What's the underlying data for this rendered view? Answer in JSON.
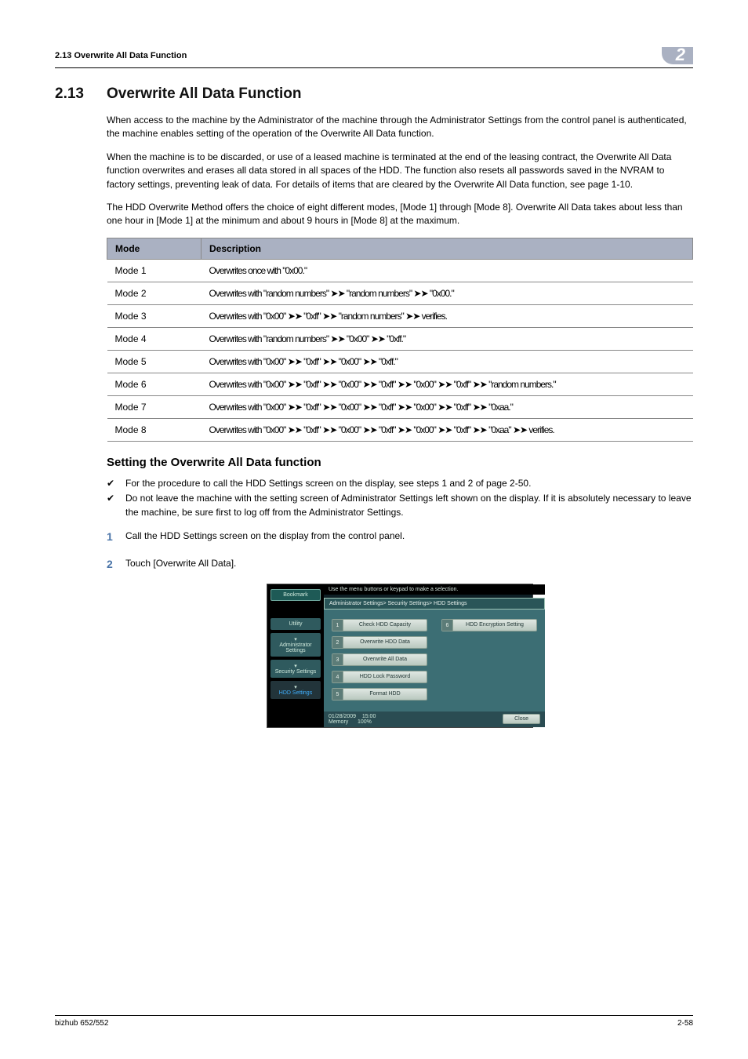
{
  "header": {
    "running_head": "2.13    Overwrite All Data Function",
    "chapter_num": "2"
  },
  "section": {
    "number": "2.13",
    "title": "Overwrite All Data Function"
  },
  "paragraphs": {
    "p1": "When access to the machine by the Administrator of the machine through the Administrator Settings from the control panel is authenticated, the machine enables setting of the operation of the Overwrite All Data function.",
    "p2": "When the machine is to be discarded, or use of a leased machine is terminated at the end of the leasing contract, the Overwrite All Data function overwrites and erases all data stored in all spaces of the HDD. The function also resets all passwords saved in the NVRAM to factory settings, preventing leak of data. For details of items that are cleared by the Overwrite All Data function, see page 1-10.",
    "p3": "The HDD Overwrite Method offers the choice of eight different modes, [Mode 1] through [Mode 8]. Overwrite All Data takes about less than one hour in [Mode 1] at the minimum and about 9 hours in [Mode 8] at the maximum."
  },
  "table": {
    "head_mode": "Mode",
    "head_desc": "Description",
    "rows": [
      {
        "mode": "Mode 1",
        "desc": "Overwrites once with \"0x00.\""
      },
      {
        "mode": "Mode 2",
        "desc": "Overwrites with \"random numbers\" ➤➤ \"random numbers\" ➤➤ \"0x00.\""
      },
      {
        "mode": "Mode 3",
        "desc": "Overwrites with \"0x00\" ➤➤ \"0xff\" ➤➤ \"random numbers\" ➤➤ verifies."
      },
      {
        "mode": "Mode 4",
        "desc": "Overwrites with \"random numbers\" ➤➤ \"0x00\" ➤➤ \"0xff.\""
      },
      {
        "mode": "Mode 5",
        "desc": "Overwrites with \"0x00\" ➤➤ \"0xff\" ➤➤ \"0x00\" ➤➤ \"0xff.\""
      },
      {
        "mode": "Mode 6",
        "desc": "Overwrites with \"0x00\" ➤➤ \"0xff\" ➤➤ \"0x00\" ➤➤ \"0xff\" ➤➤ \"0x00\" ➤➤ \"0xff\" ➤➤ \"random numbers.\""
      },
      {
        "mode": "Mode 7",
        "desc": "Overwrites with \"0x00\" ➤➤ \"0xff\" ➤➤ \"0x00\" ➤➤ \"0xff\" ➤➤ \"0x00\" ➤➤ \"0xff\" ➤➤ \"0xaa.\""
      },
      {
        "mode": "Mode 8",
        "desc": "Overwrites with \"0x00\" ➤➤ \"0xff\" ➤➤ \"0x00\" ➤➤ \"0xff\" ➤➤ \"0x00\" ➤➤ \"0xff\" ➤➤ \"0xaa\" ➤➤ verifies."
      }
    ]
  },
  "subheading": "Setting the Overwrite All Data function",
  "checks": {
    "c1": "For the procedure to call the HDD Settings screen on the display, see steps 1 and 2 of page 2-50.",
    "c2": "Do not leave the machine with the setting screen of Administrator Settings left shown on the display. If it is absolutely necessary to leave the machine, be sure first to log off from the Administrator Settings."
  },
  "steps": {
    "s1_num": "1",
    "s1_text": "Call the HDD Settings screen on the display from the control panel.",
    "s2_num": "2",
    "s2_text": "Touch [Overwrite All Data]."
  },
  "embedded_ui": {
    "instruction": "Use the menu buttons or keypad to make a selection.",
    "bookmark": "Bookmark",
    "side": {
      "utility": "Utility",
      "admin": "Administrator Settings",
      "security": "Security Settings",
      "hdd": "HDD Settings"
    },
    "breadcrumb": "Administrator Settings> Security Settings> HDD Settings",
    "buttons": {
      "b1_idx": "1",
      "b1": "Check HDD Capacity",
      "b2_idx": "2",
      "b2": "Overwrite HDD Data",
      "b3_idx": "3",
      "b3": "Overwrite All Data",
      "b4_idx": "4",
      "b4": "HDD Lock Password",
      "b5_idx": "5",
      "b5": "Format HDD",
      "b6_idx": "6",
      "b6": "HDD Encryption Setting"
    },
    "footer": {
      "date": "01/28/2009",
      "time": "15:00",
      "mem_label": "Memory",
      "mem_val": "100%",
      "close": "Close"
    }
  },
  "footer": {
    "product": "bizhub 652/552",
    "page": "2-58"
  }
}
